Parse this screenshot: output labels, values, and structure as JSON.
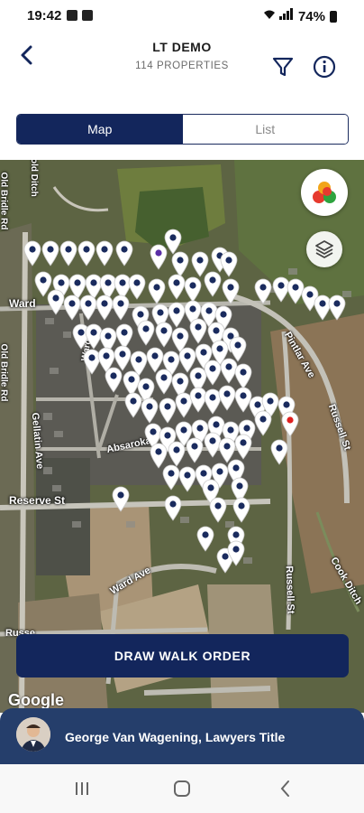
{
  "status_bar": {
    "time": "19:42",
    "battery": "74%"
  },
  "header": {
    "title": "LT DEMO",
    "subtitle": "114 PROPERTIES"
  },
  "view_toggle": {
    "map_label": "Map",
    "list_label": "List",
    "selected": "Map"
  },
  "map": {
    "streets": [
      "Ward",
      "Ward",
      "Pintlar Ave",
      "Russell St",
      "Gellatin Ave",
      "Absaroka",
      "Reserve St",
      "Ward Ave",
      "Russell St",
      "Cook Ditch",
      "Russe",
      "Old Bridle Rd",
      "Old Bridle Rd",
      "Gold Ditch"
    ],
    "google_label": "Google",
    "draw_button_label": "DRAW WALK ORDER",
    "colors": {
      "pin_dot": "#1a2b5e",
      "pin_selected": "#e02020",
      "pin_purple": "#5a2ea6"
    }
  },
  "agent": {
    "name": "George Van Wagening, Lawyers Title"
  },
  "colors": {
    "primary": "#13265c",
    "footer": "#253e6b"
  }
}
